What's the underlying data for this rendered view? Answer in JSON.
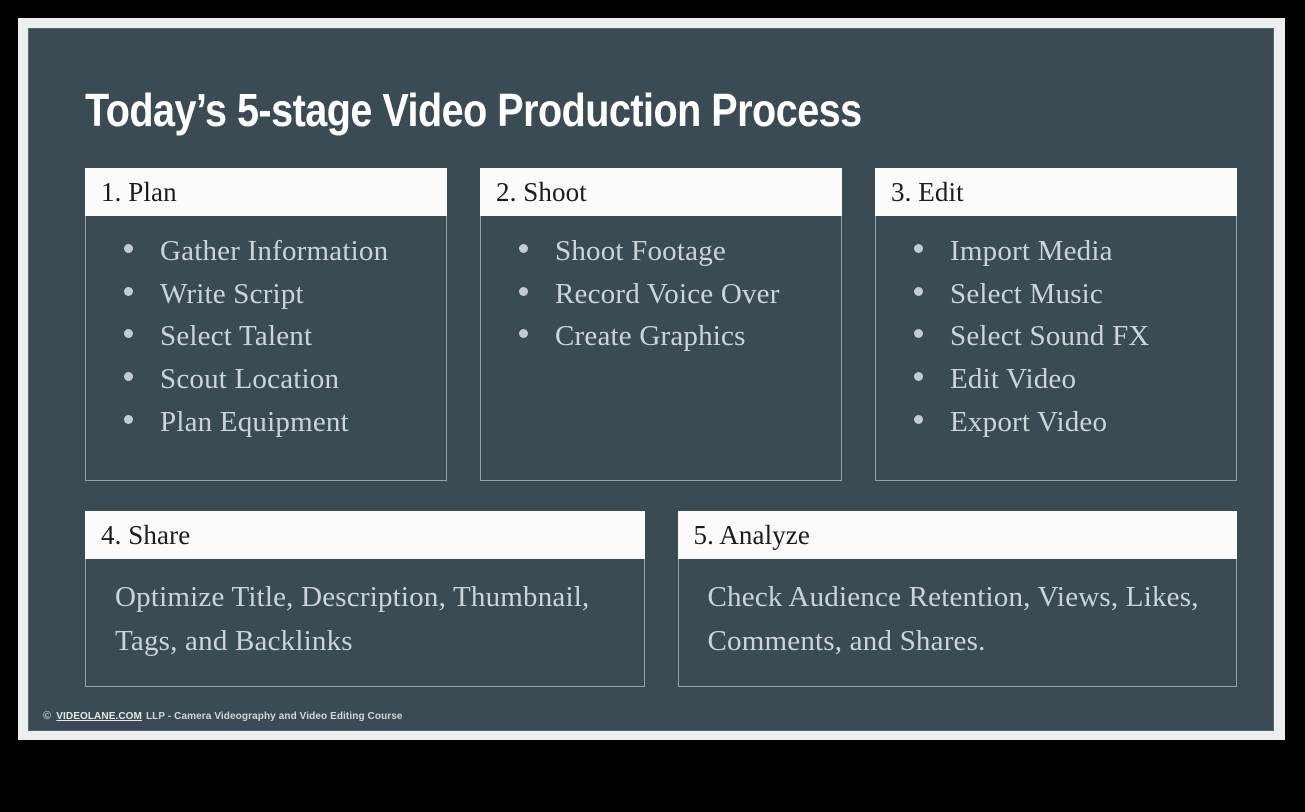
{
  "slide": {
    "title": "Today’s 5-stage Video Production Process",
    "background_color": "#3b4b53",
    "frame_color": "#eceef0",
    "page_color": "#000000",
    "accent_text_color": "#ccd4d8",
    "header_bg_color": "#fbfbf9",
    "header_text_color": "#1b1b1b",
    "card_border_color": "#93a3ab"
  },
  "cards": {
    "top_row": [
      {
        "header": "1. Plan",
        "items": [
          "Gather Information",
          "Write Script",
          "Select Talent",
          "Scout Location",
          "Plan Equipment"
        ]
      },
      {
        "header": "2. Shoot",
        "items": [
          "Shoot Footage",
          "Record Voice Over",
          "Create Graphics"
        ]
      },
      {
        "header": "3. Edit",
        "items": [
          "Import Media",
          "Select Music",
          "Select Sound FX",
          "Edit Video",
          "Export Video"
        ]
      }
    ],
    "bottom_row": [
      {
        "header": "4. Share",
        "paragraph": "Optimize Title, Description, Thumbnail, Tags, and Backlinks"
      },
      {
        "header": "5. Analyze",
        "paragraph": "Check Audience Retention, Views, Likes, Comments, and Shares."
      }
    ]
  },
  "footer": {
    "copyright_symbol": "©",
    "site": "VIDEOLANE.COM",
    "text": "LLP - Camera Videography and Video Editing Course"
  }
}
